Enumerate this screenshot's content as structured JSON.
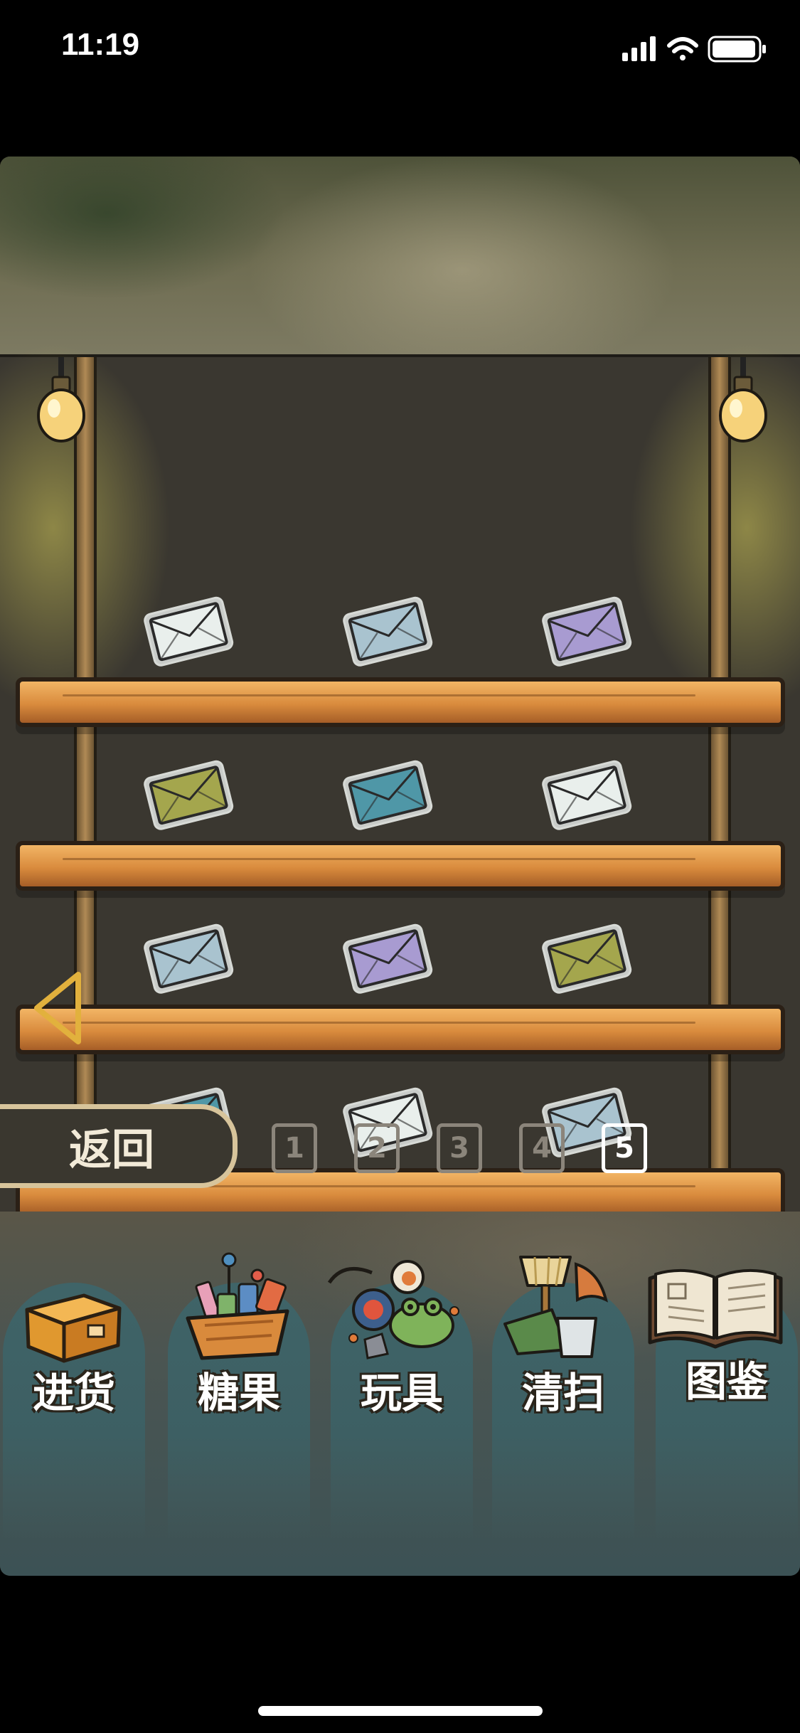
{
  "status": {
    "time": "11:19"
  },
  "back_button": {
    "label": "返回"
  },
  "pagination": {
    "pages": [
      "1",
      "2",
      "3",
      "4",
      "5"
    ],
    "current": "5"
  },
  "shelves": [
    [
      "#e9efec",
      "#a9c3cf",
      "#a89bd1"
    ],
    [
      "#a4a64d",
      "#4f97a7",
      "#e9efec"
    ],
    [
      "#a9c3cf",
      "#a89bd1",
      "#a4a64d"
    ],
    [
      "#4f97a7",
      "#e9efec",
      "#a9c3cf"
    ]
  ],
  "menu": [
    {
      "label": "进货",
      "icon": "cardboard-box-icon"
    },
    {
      "label": "糖果",
      "icon": "candy-basket-icon"
    },
    {
      "label": "玩具",
      "icon": "toy-frog-icon"
    },
    {
      "label": "清扫",
      "icon": "cleaning-tools-icon"
    },
    {
      "label": "图鉴",
      "icon": "open-book-icon"
    }
  ]
}
